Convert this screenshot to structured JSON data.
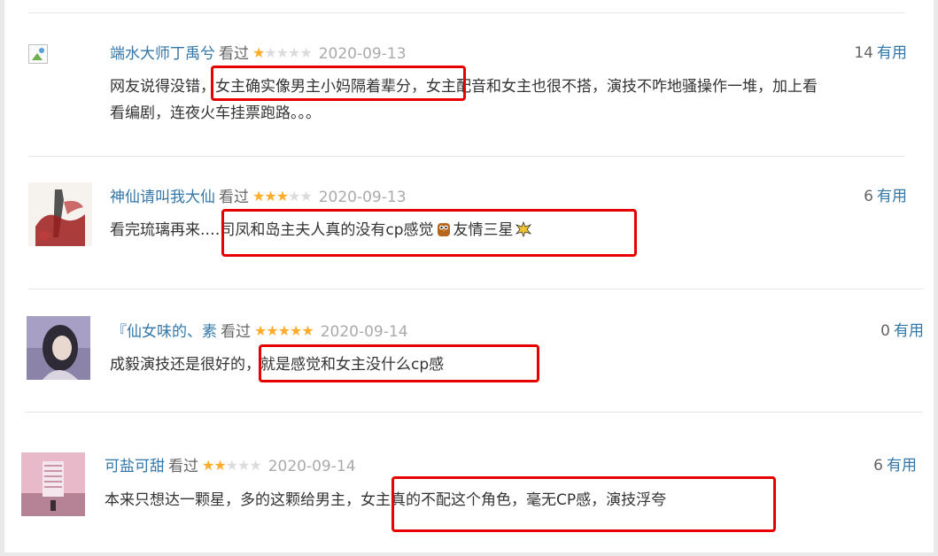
{
  "colors": {
    "link": "#3377aa",
    "star": "#ffac2d",
    "highlight": "#e60000"
  },
  "reviews": [
    {
      "user": "端水大师丁禹兮",
      "status": "看过",
      "rating": 1,
      "date": "2020-09-13",
      "votes": "14",
      "vote_label": "有用",
      "comment_line1": "网友说得没错，女主确实像男主小妈隔着辈分，女主配音和女主也很不搭，演技不咋地骚操作一堆，加上看",
      "comment_line2": "看编剧，连夜火车挂票跑路。。。",
      "avatar": "broken-image-icon"
    },
    {
      "user": "神仙请叫我大仙",
      "status": "看过",
      "rating": 3,
      "date": "2020-09-13",
      "votes": "6",
      "vote_label": "有用",
      "comment_before": "看完琉璃再来.…司凤和岛主夫人真的没有cp感觉",
      "comment_mid": "友情三星",
      "emoji1": "owl-emoji",
      "emoji2": "collision-emoji",
      "avatar": "ink-painting-avatar"
    },
    {
      "user": "『仙女味的、素",
      "status": "看过",
      "rating": 5,
      "date": "2020-09-14",
      "votes": "0",
      "vote_label": "有用",
      "comment": "成毅演技还是很好的，就是感觉和女主没什么cp感",
      "avatar": "girl-photo-avatar"
    },
    {
      "user": "可盐可甜",
      "status": "看过",
      "rating": 2,
      "date": "2020-09-14",
      "votes": "6",
      "vote_label": "有用",
      "comment": "本来只想达一颗星，多的这颗给男主，女主真的不配这个角色，毫无CP感，演技浮夸",
      "avatar": "pink-tower-avatar"
    }
  ]
}
